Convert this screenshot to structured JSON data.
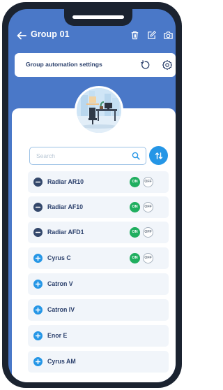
{
  "header": {
    "title": "Group 01"
  },
  "automation": {
    "label": "Group automation settings"
  },
  "search": {
    "placeholder": "Search"
  },
  "devices": [
    {
      "name": "Radiar AR10",
      "type": "remove",
      "toggle": true,
      "on_label": "ON",
      "off_label": "OFF"
    },
    {
      "name": "Radiar AF10",
      "type": "remove",
      "toggle": true,
      "on_label": "ON",
      "off_label": "OFF"
    },
    {
      "name": "Radiar AFD1",
      "type": "remove",
      "toggle": true,
      "on_label": "ON",
      "off_label": "OFF"
    },
    {
      "name": "Cyrus C",
      "type": "add",
      "toggle": true,
      "on_label": "ON",
      "off_label": "OFF"
    },
    {
      "name": "Catron V",
      "type": "add",
      "toggle": false
    },
    {
      "name": "Catron IV",
      "type": "add",
      "toggle": false
    },
    {
      "name": "Enor E",
      "type": "add",
      "toggle": false
    },
    {
      "name": "Cyrus AM",
      "type": "add",
      "toggle": false
    }
  ],
  "icons": {
    "back": "arrow-left-icon",
    "delete": "trash-icon",
    "edit": "edit-icon",
    "camera": "camera-icon",
    "refresh": "refresh-icon",
    "settings": "gear-icon",
    "search": "search-icon",
    "sort": "sort-icon",
    "remove": "minus-circle-icon",
    "add": "plus-circle-icon"
  },
  "colors": {
    "header_bg": "#4a78c8",
    "accent": "#2596e6",
    "on": "#1fae5f",
    "text": "#2a3f6b",
    "row_bg": "#f1f5fa"
  }
}
